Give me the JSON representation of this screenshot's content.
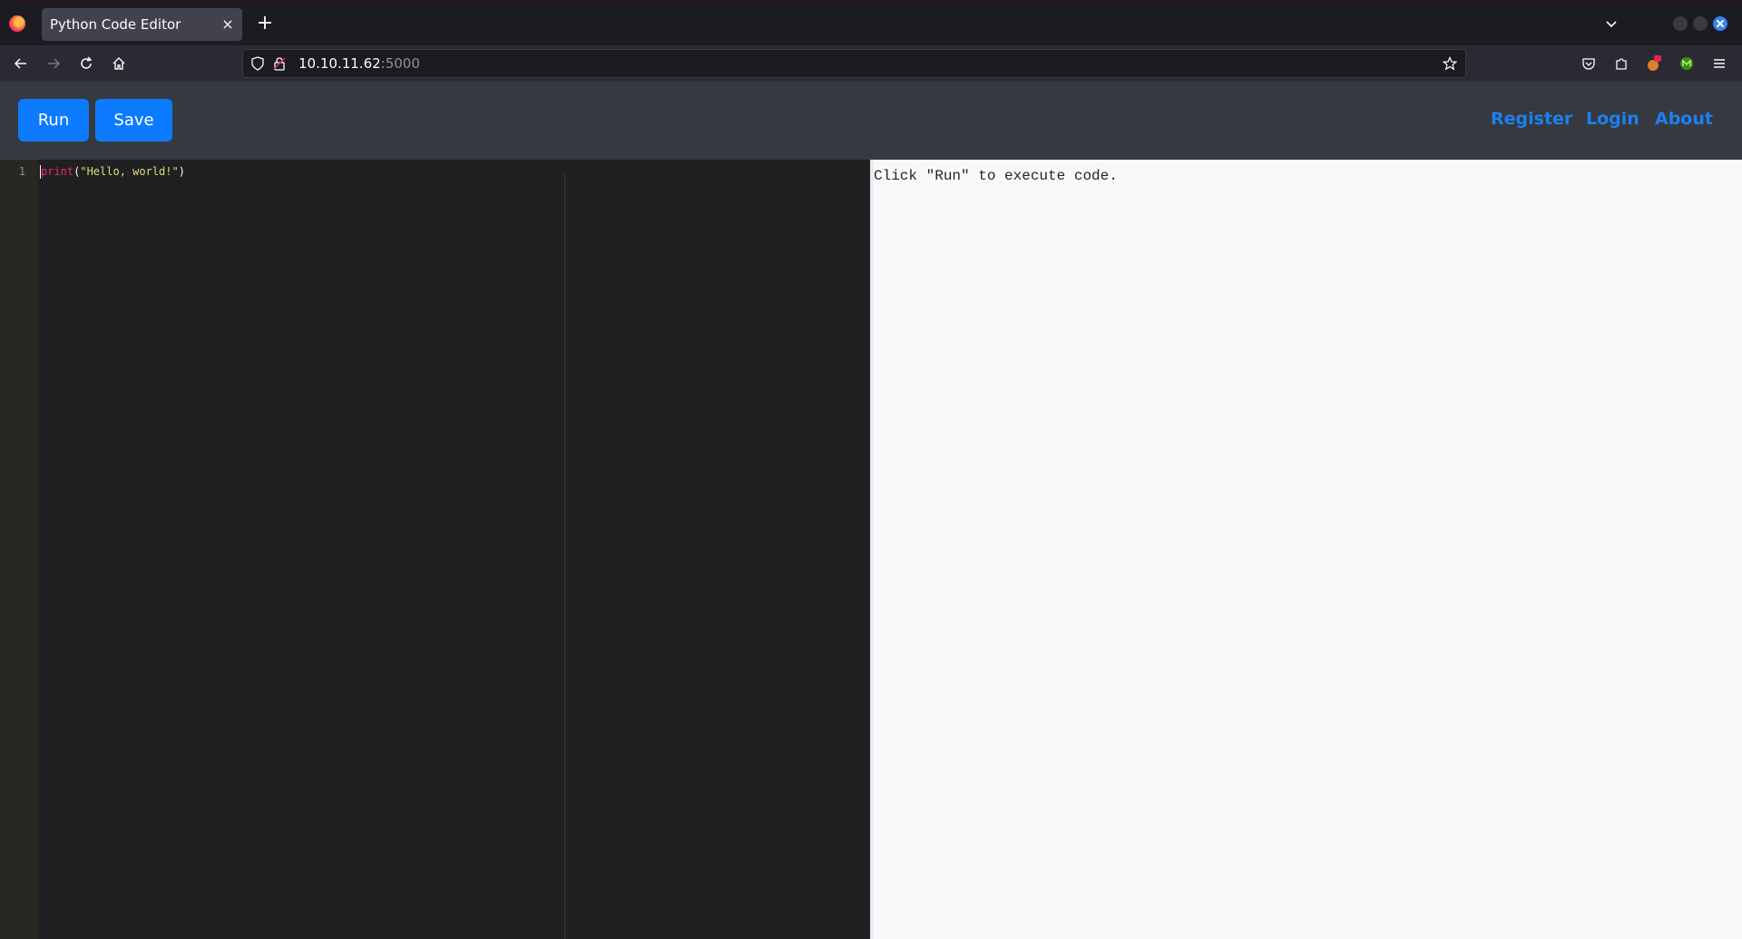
{
  "browser": {
    "tab_title": "Python Code Editor",
    "tab_close_glyph": "×",
    "new_tab_glyph": "+",
    "url_host": "10.10.11.62",
    "url_port": ":5000",
    "icons": [
      "firefox-logo-icon",
      "back-icon",
      "forward-icon",
      "reload-icon",
      "home-icon",
      "shield-icon",
      "lock-icon",
      "star-icon",
      "pocket-icon",
      "extensions-icon",
      "extension-fox-icon",
      "extension-m-icon",
      "menu-icon",
      "tab-list-icon"
    ]
  },
  "toolbar": {
    "run_label": "Run",
    "save_label": "Save"
  },
  "nav": {
    "register": "Register",
    "login": "Login",
    "about": "About"
  },
  "editor": {
    "line_number": "1",
    "code_keyword": "print",
    "code_open": "(",
    "code_string": "\"Hello, world!\"",
    "code_close": ")"
  },
  "output": {
    "text": "Click \"Run\" to execute code."
  },
  "colors": {
    "accent": "#0d7bff",
    "link": "#1e7ff0",
    "header_bg": "#353a40",
    "editor_bg": "#1f2021",
    "output_bg": "#f8f9fa"
  }
}
